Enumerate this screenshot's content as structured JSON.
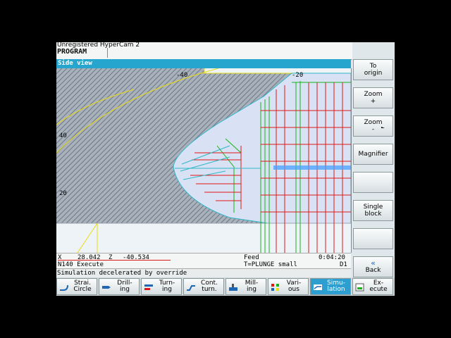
{
  "overlay": {
    "watermark": "Unregistered HyperCam 2"
  },
  "header": {
    "area": "PROGRAM"
  },
  "view": {
    "title": "Side view",
    "x_ticks": [
      "-40",
      "-20"
    ],
    "y_ticks": [
      "40",
      "20"
    ],
    "colors": {
      "stock": "#8d96a3",
      "part": "#d8e2f4",
      "red_path": "#e01818",
      "green_path": "#18b418",
      "yellow_contour": "#e8dc10",
      "cyan_path": "#2fb7c8",
      "highlight": "#4aa0ff"
    }
  },
  "status": {
    "x_label": "X",
    "x_value": "28.042",
    "z_label": "Z",
    "z_value": "-40.534",
    "block": "N140 Execute",
    "feed_label": "Feed",
    "tool": "T=PLUNGE small",
    "time": "0:04:20",
    "d_label": "D1",
    "message": "Simulation decelerated by override"
  },
  "vertical_softkeys": [
    {
      "l1": "To",
      "l2": "origin"
    },
    {
      "l1": "Zoom",
      "l2": "+"
    },
    {
      "l1": "Zoom",
      "l2": "-"
    },
    {
      "l1": "Magnifier",
      "l2": ""
    },
    {
      "l1": "",
      "l2": ""
    },
    {
      "l1": "Single",
      "l2": "block"
    },
    {
      "l1": "",
      "l2": ""
    },
    {
      "l1": "Back",
      "l2": "",
      "icon": "double-chevron-left-icon"
    }
  ],
  "horizontal_softkeys": [
    {
      "l1": "Strai.",
      "l2": "Circle",
      "icon": "straight-circle-icon"
    },
    {
      "l1": "Drill-",
      "l2": "ing",
      "icon": "drilling-icon"
    },
    {
      "l1": "Turn-",
      "l2": "ing",
      "icon": "turning-icon"
    },
    {
      "l1": "Cont.",
      "l2": "turn.",
      "icon": "contour-turning-icon"
    },
    {
      "l1": "Mill-",
      "l2": "ing",
      "icon": "milling-icon"
    },
    {
      "l1": "Vari-",
      "l2": "ous",
      "icon": "various-icon"
    },
    {
      "l1": "Simu-",
      "l2": "lation",
      "icon": "simulation-icon",
      "active": true
    },
    {
      "l1": "Ex-",
      "l2": "ecute",
      "icon": "execute-icon"
    }
  ]
}
